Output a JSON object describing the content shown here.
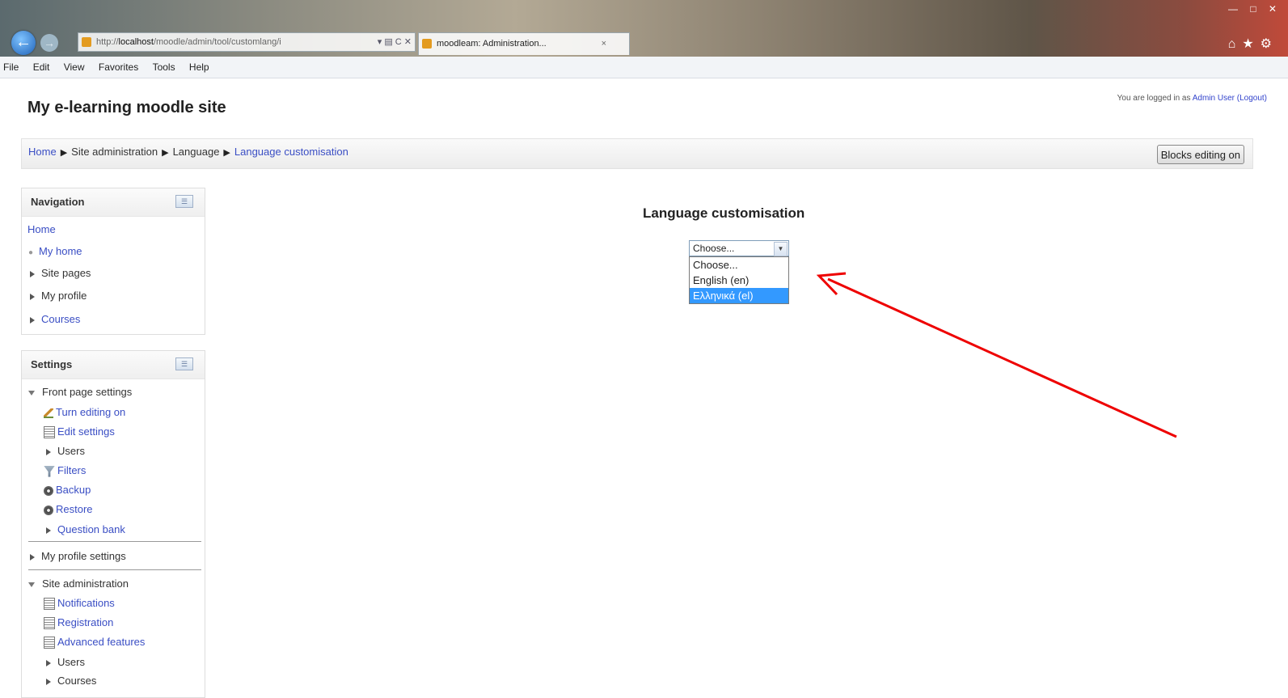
{
  "browser": {
    "url_prefix": "http://",
    "url_host": "localhost",
    "url_rest": "/moodle/admin/tool/customlang/i",
    "address_controls": "▾ ▤ C ✕",
    "tab_title": "moodleam: Administration...",
    "tab_close": "×",
    "menu": [
      "File",
      "Edit",
      "View",
      "Favorites",
      "Tools",
      "Help"
    ]
  },
  "site": {
    "title": "My e-learning moodle site",
    "login_prefix": "You are logged in as",
    "login_user": "Admin User",
    "logout": "(Logout)"
  },
  "breadcrumb": [
    "Home",
    "Site administration",
    "Language",
    "Language customisation"
  ],
  "blocks_button": "Blocks editing on",
  "navigation": {
    "title": "Navigation",
    "items": [
      "Home",
      "My home",
      "Site pages",
      "My profile",
      "Courses"
    ]
  },
  "settings": {
    "title": "Settings",
    "front_page": "Front page settings",
    "front_items": [
      "Turn editing on",
      "Edit settings",
      "Users",
      "Filters",
      "Backup",
      "Restore",
      "Question bank"
    ],
    "profile_settings": "My profile settings",
    "site_admin": "Site administration",
    "admin_items": [
      "Notifications",
      "Registration",
      "Advanced features",
      "Users",
      "Courses"
    ]
  },
  "main": {
    "heading": "Language customisation",
    "select_value": "Choose...",
    "options": [
      "Choose...",
      "English (en)",
      "Ελληνικά (el)"
    ],
    "selected_index": 2
  },
  "colors": {
    "annotation_arrow": "#ee0000",
    "link": "#3a4ec4",
    "selection": "#3399ff"
  }
}
